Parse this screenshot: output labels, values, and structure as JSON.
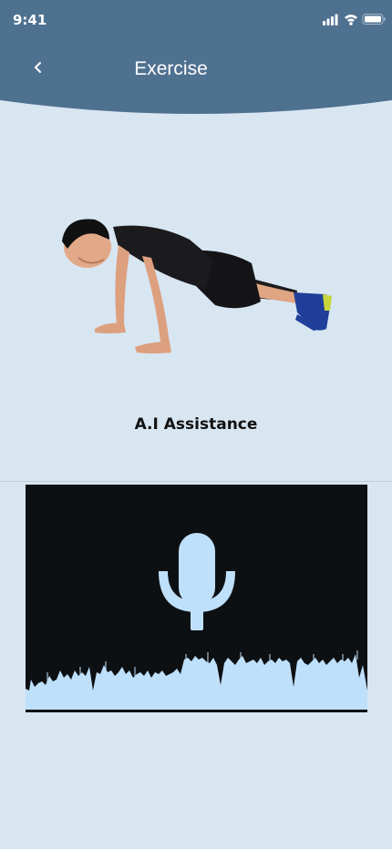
{
  "status_bar": {
    "time": "9:41",
    "icons": [
      "signal-icon",
      "wifi-icon",
      "battery-icon"
    ]
  },
  "header": {
    "back_icon": "chevron-left-icon",
    "title": "Exercise",
    "background_color": "#4f7190"
  },
  "exercise": {
    "image": "person-doing-push-up-plank"
  },
  "assistant": {
    "label": "A.I Assistance",
    "icon": "microphone-icon",
    "accent_color": "#bfe0fb",
    "panel_color": "#0d1013"
  }
}
